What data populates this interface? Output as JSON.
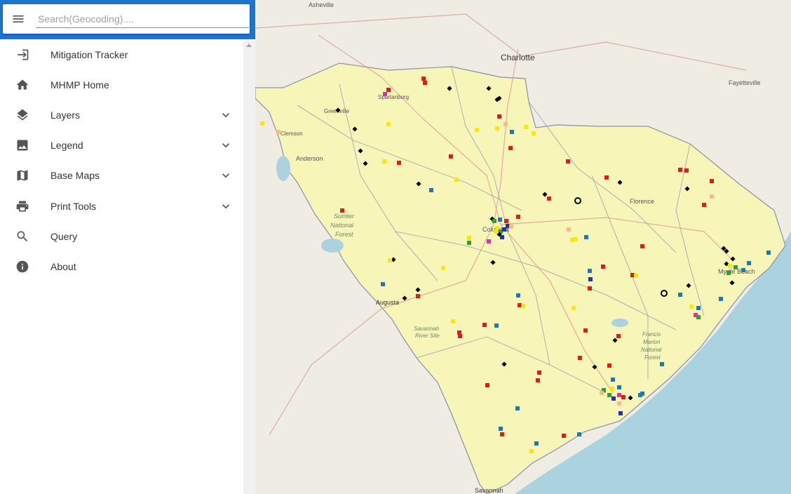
{
  "search": {
    "placeholder": "Search(Geocoding)...."
  },
  "menu": {
    "items": [
      {
        "label": "Mitigation Tracker",
        "icon": "login-icon",
        "expandable": false
      },
      {
        "label": "MHMP Home",
        "icon": "home-icon",
        "expandable": false
      },
      {
        "label": "Layers",
        "icon": "layers-icon",
        "expandable": true
      },
      {
        "label": "Legend",
        "icon": "image-icon",
        "expandable": true
      },
      {
        "label": "Base Maps",
        "icon": "map-icon",
        "expandable": true
      },
      {
        "label": "Print Tools",
        "icon": "printer-icon",
        "expandable": true
      },
      {
        "label": "Query",
        "icon": "search-icon",
        "expandable": false
      },
      {
        "label": "About",
        "icon": "info-icon",
        "expandable": false
      }
    ]
  },
  "map": {
    "labels": {
      "asheville": "Asheville",
      "charlotte": "Charlotte",
      "fayetteville": "Fayetteville",
      "spartanburg": "Spartanburg",
      "greenville": "Greenville",
      "clemson": "Clemson",
      "anderson": "Anderson",
      "sumter_nf_1": "Sumter",
      "sumter_nf_2": "National",
      "sumter_nf_3": "Forest",
      "florence": "Florence",
      "columbia": "Columbia",
      "augusta": "Augusta",
      "savannah_river_1": "Savannah",
      "savannah_river_2": "River Site",
      "myrtle_beach": "Myrtle Beach",
      "francis_marion_1": "Francis",
      "francis_marion_2": "Marion",
      "francis_marion_3": "National",
      "francis_marion_4": "Forest",
      "savannah": "Savannah"
    },
    "colors": {
      "ocean": "#aad3df",
      "land": "#f2efe9",
      "state": "#f7f5b8",
      "red": "#e31a1c",
      "blue": "#1f78b4",
      "yellow": "#ffe600",
      "green": "#33a02c",
      "magenta": "#d633a8",
      "salmon": "#fdb98a",
      "navy": "#2233aa",
      "black": "#000000"
    }
  }
}
